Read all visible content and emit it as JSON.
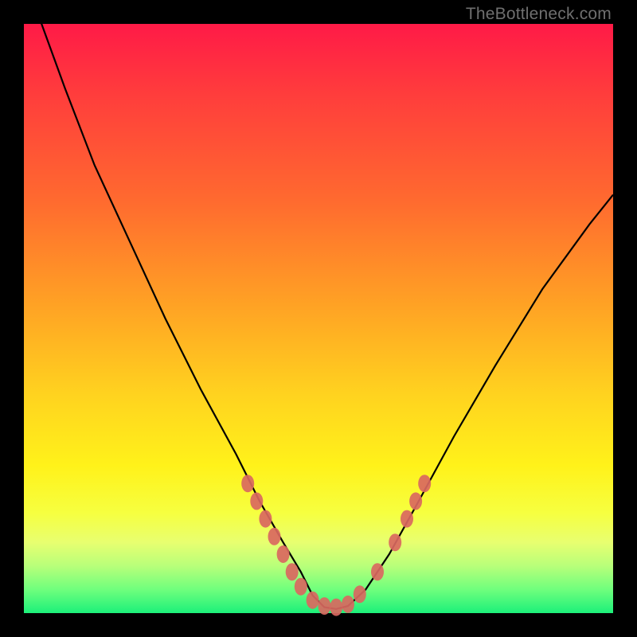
{
  "watermark": "TheBottleneck.com",
  "chart_data": {
    "type": "line",
    "title": "",
    "xlabel": "",
    "ylabel": "",
    "xlim": [
      0,
      100
    ],
    "ylim": [
      0,
      100
    ],
    "grid": false,
    "curve": {
      "comment": "V-shaped bottleneck curve; x is normalized 0-100 left-to-right, y is 0-100 bottom-to-top",
      "x": [
        0,
        3,
        7,
        12,
        18,
        24,
        30,
        36,
        40,
        44,
        47,
        49,
        51,
        53,
        55,
        58,
        62,
        67,
        73,
        80,
        88,
        96,
        100
      ],
      "y": [
        110,
        100,
        89,
        76,
        63,
        50,
        38,
        27,
        19,
        12,
        7,
        3,
        1,
        0.7,
        1.2,
        4,
        10,
        19,
        30,
        42,
        55,
        66,
        71
      ]
    },
    "markers": {
      "comment": "pink dots clustered near the valley and partway up each arm",
      "points": [
        {
          "x": 38,
          "y": 22
        },
        {
          "x": 39.5,
          "y": 19
        },
        {
          "x": 41,
          "y": 16
        },
        {
          "x": 42.5,
          "y": 13
        },
        {
          "x": 44,
          "y": 10
        },
        {
          "x": 45.5,
          "y": 7
        },
        {
          "x": 47,
          "y": 4.5
        },
        {
          "x": 49,
          "y": 2.2
        },
        {
          "x": 51,
          "y": 1.2
        },
        {
          "x": 53,
          "y": 1
        },
        {
          "x": 55,
          "y": 1.5
        },
        {
          "x": 57,
          "y": 3.2
        },
        {
          "x": 60,
          "y": 7
        },
        {
          "x": 63,
          "y": 12
        },
        {
          "x": 65,
          "y": 16
        },
        {
          "x": 66.5,
          "y": 19
        },
        {
          "x": 68,
          "y": 22
        }
      ]
    },
    "colors": {
      "gradient_top": "#ff1a47",
      "gradient_mid": "#ffd31f",
      "gradient_bottom": "#1cf07a",
      "curve": "#000000",
      "marker": "#d9685f",
      "frame": "#000000"
    }
  }
}
